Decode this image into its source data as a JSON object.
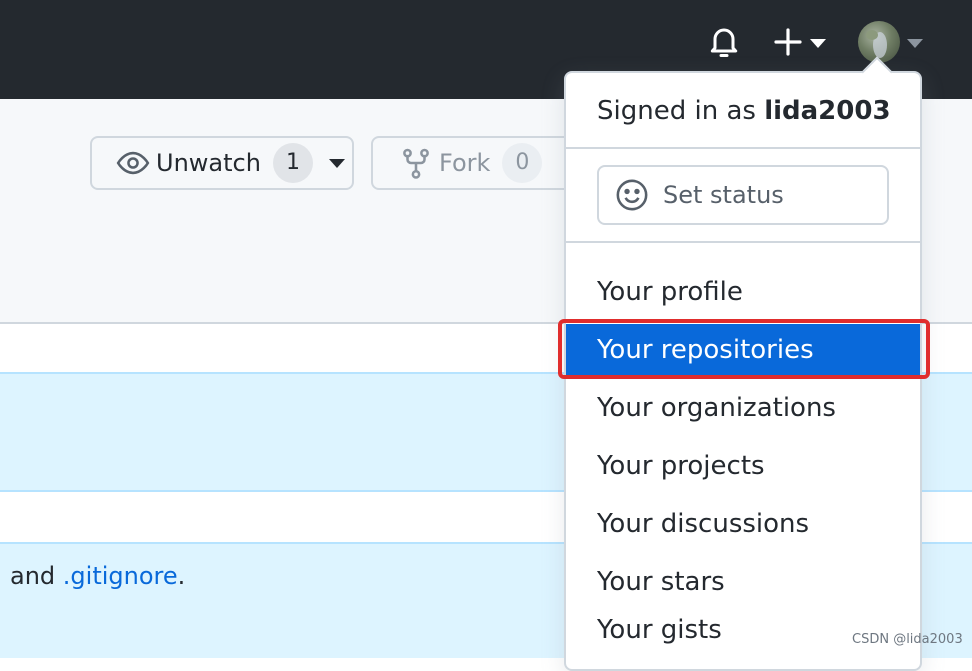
{
  "header": {
    "icons": [
      "bell-icon",
      "plus-icon",
      "caret-down-icon",
      "avatar",
      "caret-down-icon"
    ]
  },
  "repo_actions": {
    "unwatch_label": "Unwatch",
    "unwatch_count": "1",
    "fork_label": "Fork",
    "fork_count": "0"
  },
  "banner": {
    "text_before": "and ",
    "link": ".gitignore",
    "text_after": "."
  },
  "user_menu": {
    "signed_prefix": "Signed in as ",
    "username": "lida2003",
    "set_status": "Set status",
    "items": [
      {
        "label": "Your profile"
      },
      {
        "label": "Your repositories",
        "active": true
      },
      {
        "label": "Your organizations"
      },
      {
        "label": "Your projects"
      },
      {
        "label": "Your discussions"
      },
      {
        "label": "Your stars"
      },
      {
        "label": "Your gists"
      }
    ]
  },
  "watermark": "CSDN @lida2003",
  "colors": {
    "header_bg": "#24292f",
    "active_item": "#0969da",
    "highlight_border": "#e02d2d",
    "link": "#0969da"
  }
}
